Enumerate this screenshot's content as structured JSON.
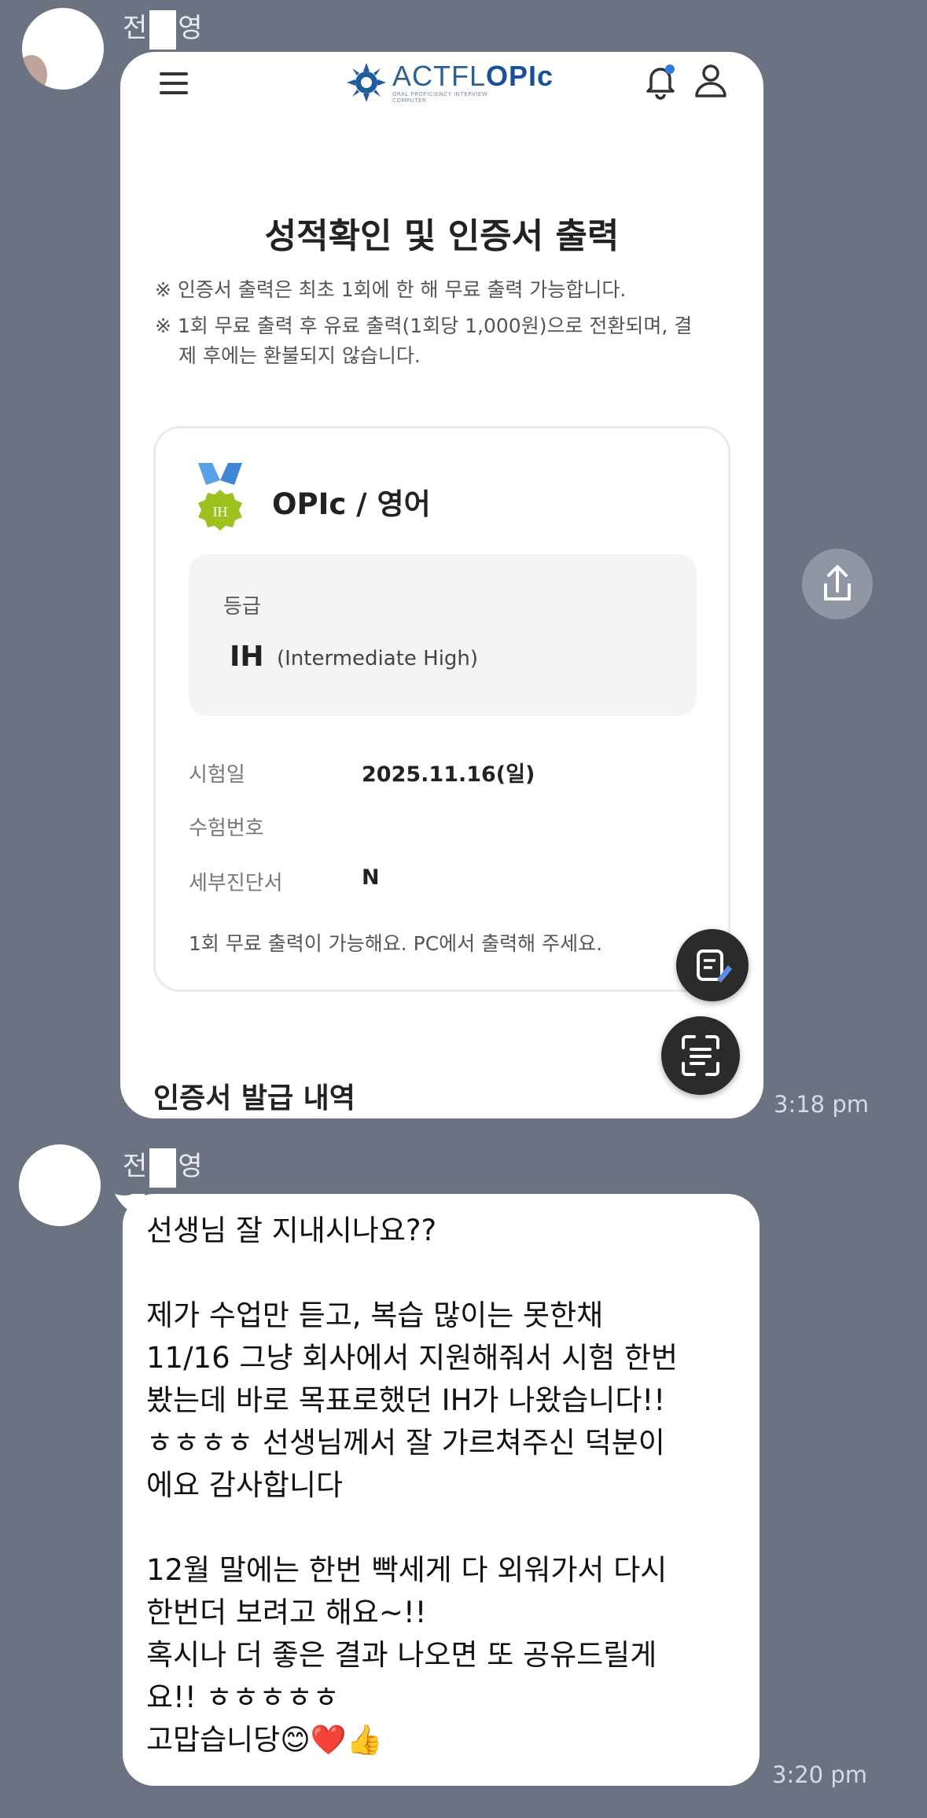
{
  "chat": {
    "bg_color": "#6b7383",
    "messages": [
      {
        "sender_prefix": "전",
        "sender_suffix": "영",
        "time": "3:18 pm",
        "type": "image"
      },
      {
        "sender_prefix": "전",
        "sender_suffix": "영",
        "time": "3:20 pm",
        "type": "text",
        "lines": [
          "선생님 잘 지내시나요??",
          "",
          "제가 수업만 듣고, 복습 많이는 못한채",
          "11/16 그냥 회사에서 지원해줘서 시험 한번",
          "봤는데 바로 목표로했던 IH가 나왔습니다!!",
          "ㅎㅎㅎㅎ 선생님께서 잘 가르쳐주신 덕분이",
          "에요 감사합니다",
          "",
          "12월 말에는 한번 빡세게 다 외워가서 다시",
          "한번더 보려고 해요~!!",
          "혹시나 더 좋은 결과 나오면 또 공유드릴게",
          "요!! ㅎㅎㅎㅎㅎ",
          "고맙습니당😊❤️👍"
        ]
      }
    ]
  },
  "screenshot": {
    "logo": {
      "brand_plain": "ACTFL",
      "brand_bold": "OPIc",
      "tagline": "ORAL PROFICIENCY INTERVIEW",
      "tagline2": "COMPUTER"
    },
    "icons": {
      "menu": "hamburger-icon",
      "bell": "bell-icon",
      "user": "user-icon"
    },
    "page_title": "성적확인 및 인증서 출력",
    "notices": [
      "※ 인증서 출력은 최초 1회에 한 해 무료 출력 가능합니다.",
      "※ 1회 무료 출력 후 유료 출력(1회당 1,000원)으로 전환되며, 결",
      "제 후에는 환불되지 않습니다."
    ],
    "card": {
      "medal_text": "IH",
      "exam_name": "OPIc / 영어",
      "grade_label": "등급",
      "grade_value": "IH",
      "grade_desc": "(Intermediate High)",
      "rows": [
        {
          "label": "시험일",
          "value": "2025.11.16(일)"
        },
        {
          "label": "수험번호",
          "value": ""
        },
        {
          "label": "세부진단서",
          "value": "N"
        }
      ],
      "note": "1회 무료 출력이 가능해요. PC에서 출력해 주세요."
    },
    "history_title": "인증서 발급 내역",
    "accent_color": "#1b4f9a",
    "medal_color": "#9dc21f"
  }
}
